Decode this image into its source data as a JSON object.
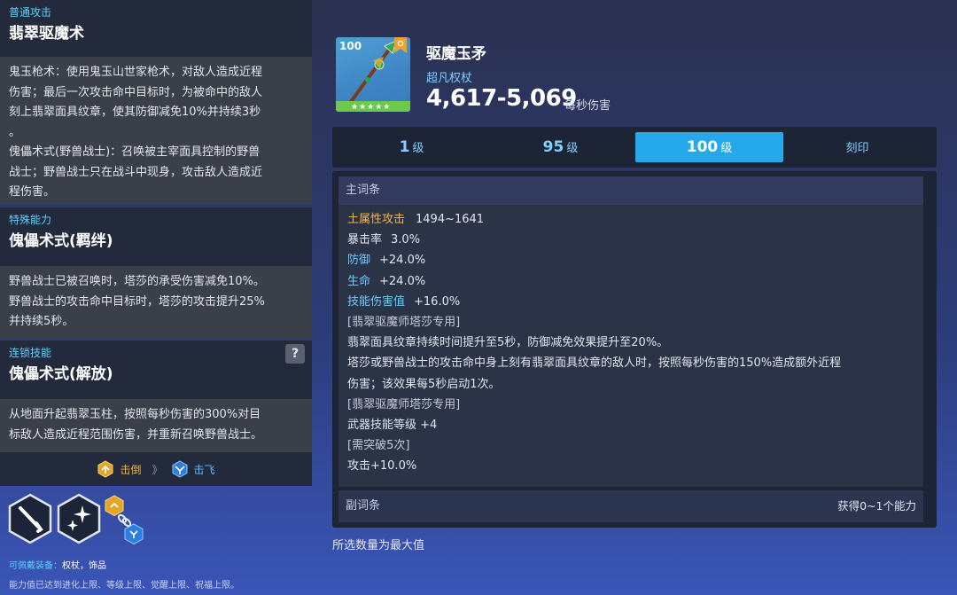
{
  "left": {
    "basic": {
      "tag": "普通攻击",
      "title": "翡翠驱魔术",
      "lines": [
        "鬼玉枪术：使用鬼玉山世家枪术，对敌人造成近程",
        "伤害；最后一次攻击命中目标时，为被命中的敌人",
        "刻上翡翠面具纹章，使其防御减免10%并持续3秒",
        "。",
        "傀儡术式(野兽战士)：召唤被主宰面具控制的野兽",
        "战士；野兽战士只在战斗中现身，攻击敌人造成近",
        "程伤害。"
      ]
    },
    "special": {
      "tag": "特殊能力",
      "title": "傀儡术式(羁绊)",
      "lines": [
        "野兽战士已被召唤时，塔莎的承受伤害减免10%。",
        "野兽战士的攻击命中目标时，塔莎的攻击提升25%",
        "并持续5秒。"
      ]
    },
    "chain": {
      "tag": "连锁技能",
      "title": "傀儡术式(解放)",
      "help": "?",
      "lines": [
        "从地面升起翡翠玉柱，按照每秒伤害的300%对目",
        "标敌人造成近程范围伤害，并重新召唤野兽战士。"
      ]
    },
    "effects": {
      "first": "击倒",
      "arrow": "》",
      "second": "击飞"
    },
    "equip_label": "可佩戴装备：",
    "equip_value": "权杖，饰品",
    "limit_note": "能力值已达到进化上限、等级上限、觉醒上限、祝福上限。"
  },
  "weapon": {
    "level_badge": "100",
    "stars": "★★★★★",
    "name": "驱魔玉矛",
    "type": "超凡权杖",
    "dps": "4,617-5,069",
    "dps_unit": "每秒伤害"
  },
  "tabs": [
    {
      "num": "1",
      "unit": "级",
      "active": false
    },
    {
      "num": "95",
      "unit": "级",
      "active": false
    },
    {
      "num": "100",
      "unit": "级",
      "active": true
    },
    {
      "label": "刻印",
      "active": false
    }
  ],
  "main": {
    "header": "主词条",
    "stats": [
      {
        "name": "土属性攻击",
        "value": "1494~1641",
        "color": "orange"
      },
      {
        "name": "暴击率",
        "value": "3.0%",
        "color": "white"
      },
      {
        "name": "防御",
        "value": "+24.0%",
        "color": "blue"
      },
      {
        "name": "生命",
        "value": "+24.0%",
        "color": "blue"
      },
      {
        "name": "技能伤害值",
        "value": "+16.0%",
        "color": "blue"
      }
    ],
    "text_lines": [
      "[翡翠驱魔师塔莎专用]",
      "翡翠面具纹章持续时间提升至5秒，防御减免效果提升至20%。",
      "塔莎或野兽战士的攻击命中身上刻有翡翠面具纹章的敌人时，按照每秒伤害的150%造成额外近程",
      "伤害；该效果每5秒启动1次。",
      "[翡翠驱魔师塔莎专用]",
      "武器技能等级 +4",
      "[需突破5次]",
      "攻击+10.0%"
    ],
    "sub_header": "副词条",
    "sub_right": "获得0~1个能力"
  },
  "footer_note": "所选数量为最大值"
}
